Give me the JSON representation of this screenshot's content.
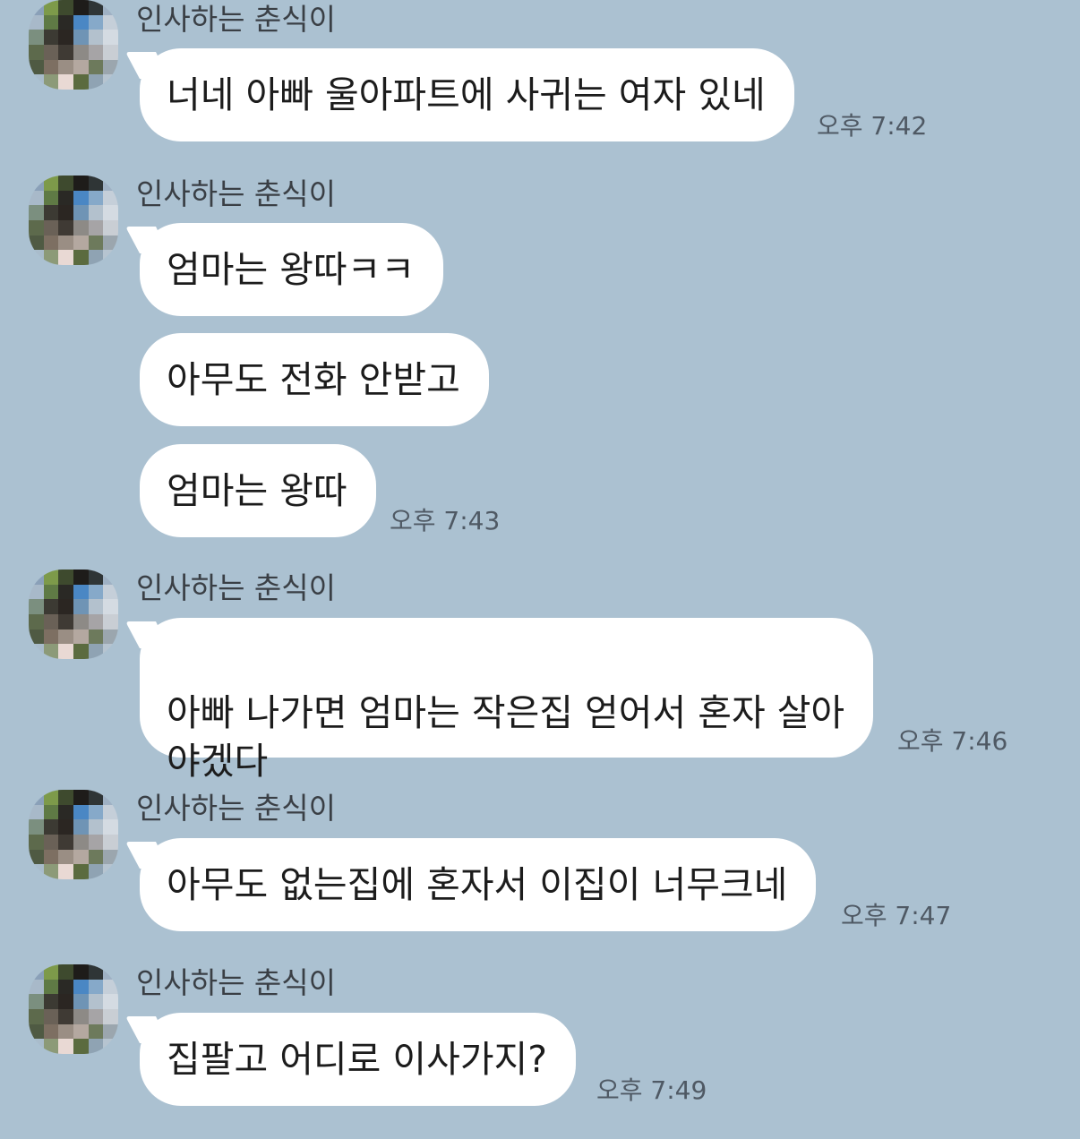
{
  "messages": [
    {
      "sender": "인사하는 춘식이",
      "bubbles": [
        "너네 아빠 울아파트에 사귀는 여자 있네"
      ],
      "time": "오후 7:42"
    },
    {
      "sender": "인사하는 춘식이",
      "bubbles": [
        "엄마는 왕따ㅋㅋ",
        "아무도 전화 안받고",
        "엄마는 왕따"
      ],
      "time": "오후 7:43"
    },
    {
      "sender": "인사하는 춘식이",
      "bubbles": [
        "아빠 나가면 엄마는 작은집 얻어서 혼자 살아\n야겠다"
      ],
      "time": "오후 7:46"
    },
    {
      "sender": "인사하는 춘식이",
      "bubbles": [
        "아무도 없는집에 혼자서 이집이 너무크네"
      ],
      "time": "오후 7:47"
    },
    {
      "sender": "인사하는 춘식이",
      "bubbles": [
        "집팔고 어디로 이사가지?"
      ],
      "time": "오후 7:49"
    }
  ],
  "avatar_icon": "pixelated-profile-avatar",
  "colors": {
    "background": "#abc1d1",
    "bubble": "#ffffff",
    "sender_text": "#3a3f45",
    "time_text": "#4f5964"
  }
}
